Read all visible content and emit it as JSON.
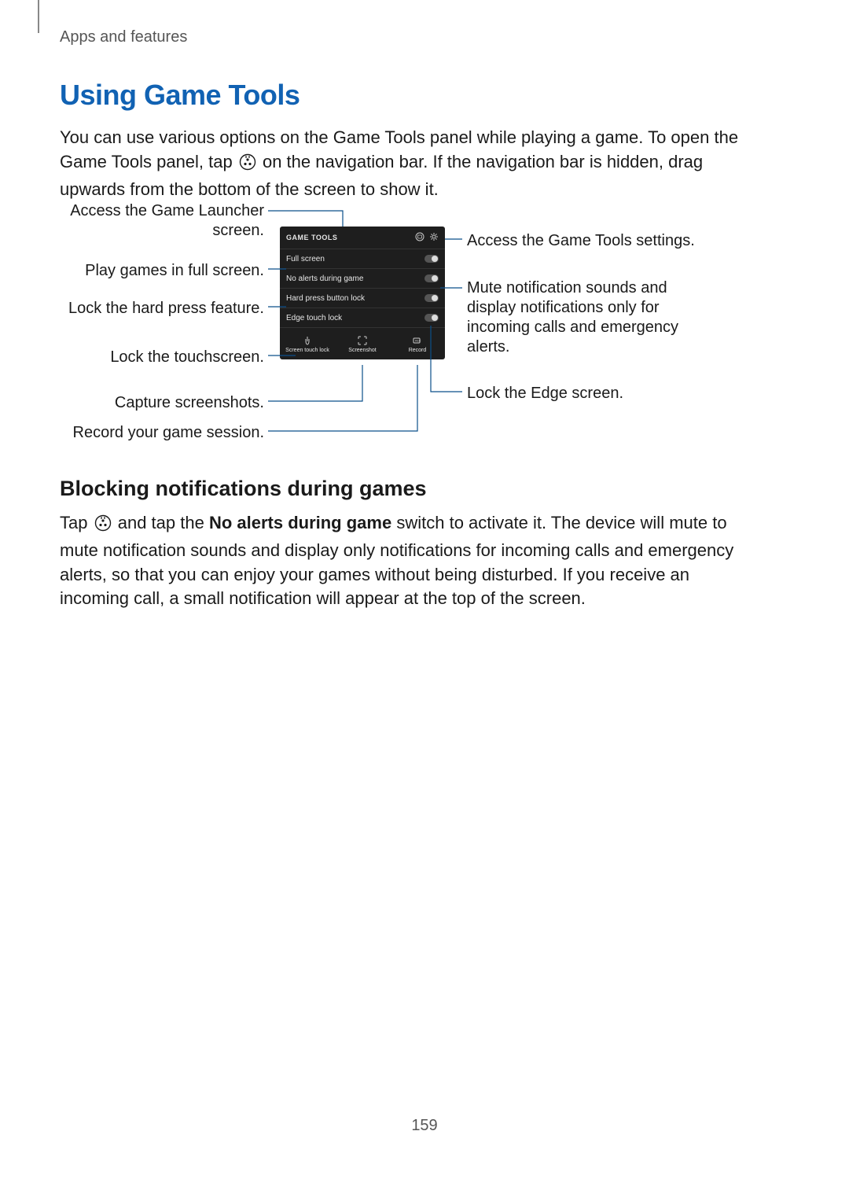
{
  "breadcrumb": "Apps and features",
  "page_number": "159",
  "heading1": "Using Game Tools",
  "intro_before_icon": "You can use various options on the Game Tools panel while playing a game. To open the Game Tools panel, tap ",
  "intro_after_icon": " on the navigation bar. If the navigation bar is hidden, drag upwards from the bottom of the screen to show it.",
  "heading2": "Blocking notifications during games",
  "blocking_before_icon": "Tap ",
  "blocking_after_icon": " and tap the ",
  "blocking_bold": "No alerts during game",
  "blocking_rest": " switch to activate it. The device will mute to mute notification sounds and display only notifications for incoming calls and emergency alerts, so that you can enjoy your games without being disturbed. If you receive an incoming call, a small notification will appear at the top of the screen.",
  "panel": {
    "title": "GAME TOOLS",
    "toggles": {
      "full_screen": "Full screen",
      "no_alerts": "No alerts during game",
      "hard_press": "Hard press button lock",
      "edge_touch": "Edge touch lock"
    },
    "actions": {
      "screen_touch_lock": "Screen touch lock",
      "screenshot": "Screenshot",
      "record": "Record"
    }
  },
  "labels_left": {
    "launcher": "Access the Game Launcher screen.",
    "full_screen": "Play games in full screen.",
    "hard_press": "Lock the hard press feature.",
    "touchscreen": "Lock the touchscreen.",
    "screenshots": "Capture screenshots.",
    "record": "Record your game session."
  },
  "labels_right": {
    "settings": "Access the Game Tools settings.",
    "mute": "Mute notification sounds and display notifications only for incoming calls and emergency alerts.",
    "edge": "Lock the Edge screen."
  }
}
